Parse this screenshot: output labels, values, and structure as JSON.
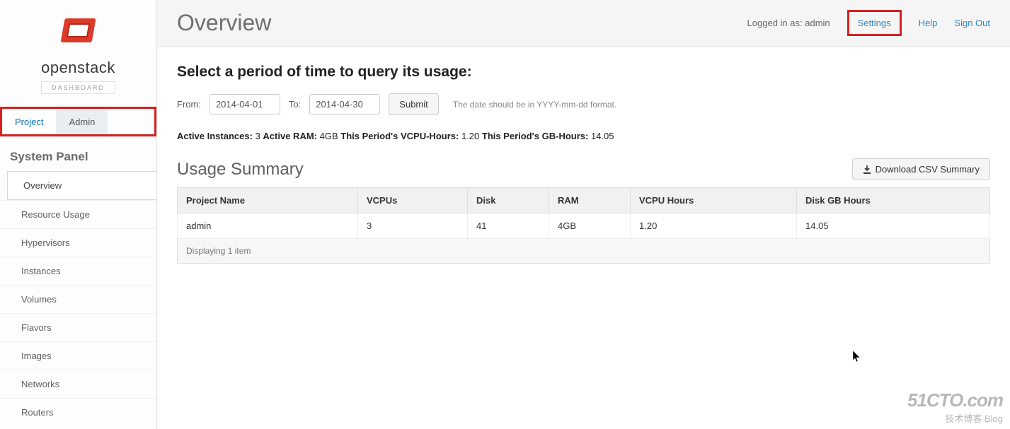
{
  "brand": {
    "name": "openstack",
    "badge": "DASHBOARD"
  },
  "tabs": {
    "project": "Project",
    "admin": "Admin"
  },
  "panel": {
    "title": "System Panel",
    "items": [
      "Overview",
      "Resource Usage",
      "Hypervisors",
      "Instances",
      "Volumes",
      "Flavors",
      "Images",
      "Networks",
      "Routers"
    ]
  },
  "topbar": {
    "logged_in_as_label": "Logged in as:",
    "user": "admin",
    "links": {
      "settings": "Settings",
      "help": "Help",
      "sign_out": "Sign Out"
    }
  },
  "page": {
    "title": "Overview"
  },
  "query": {
    "heading": "Select a period of time to query its usage:",
    "from_label": "From:",
    "from_value": "2014-04-01",
    "to_label": "To:",
    "to_value": "2014-04-30",
    "submit": "Submit",
    "hint": "The date should be in YYYY-mm-dd format."
  },
  "stats": {
    "active_instances_label": "Active Instances:",
    "active_instances_value": "3",
    "active_ram_label": "Active RAM:",
    "active_ram_value": "4GB",
    "vcpu_hours_label": "This Period's VCPU-Hours:",
    "vcpu_hours_value": "1.20",
    "gb_hours_label": "This Period's GB-Hours:",
    "gb_hours_value": "14.05"
  },
  "summary": {
    "title": "Usage Summary",
    "download_label": "Download CSV Summary",
    "columns": [
      "Project Name",
      "VCPUs",
      "Disk",
      "RAM",
      "VCPU Hours",
      "Disk GB Hours"
    ],
    "rows": [
      {
        "project": "admin",
        "vcpus": "3",
        "disk": "41",
        "ram": "4GB",
        "vcpu_hours": "1.20",
        "disk_gb_hours": "14.05"
      }
    ],
    "footer": "Displaying 1 item"
  },
  "watermark": {
    "line1": "51CTO.com",
    "line2": "技术博客   Blog"
  }
}
